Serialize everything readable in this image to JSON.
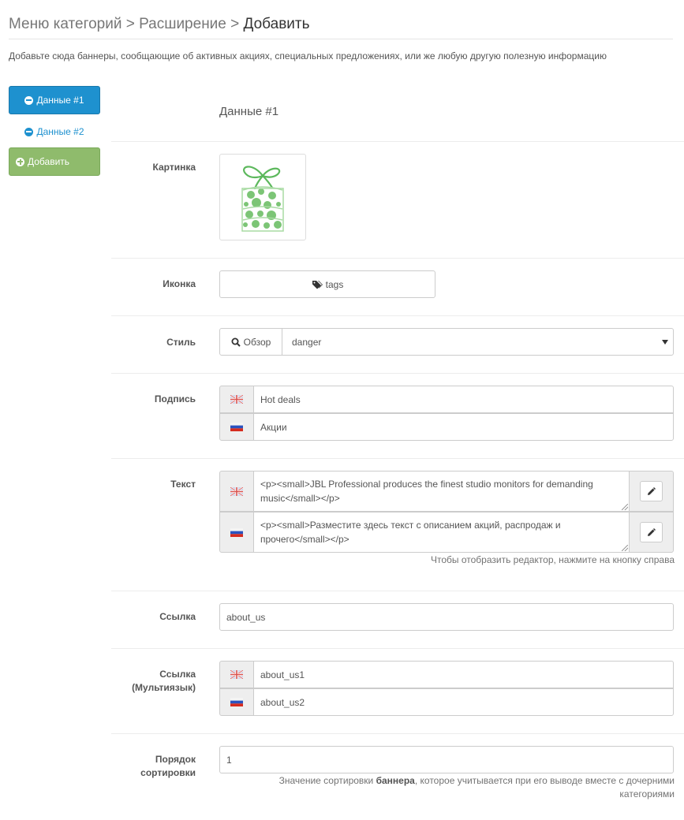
{
  "breadcrumb": {
    "part1": "Меню категорий",
    "sep1": " > ",
    "part2": "Расширение",
    "sep2": " > ",
    "current": "Добавить"
  },
  "intro": "Добавьте сюда баннеры, сообщающие об активных акциях, специальных предложениях, или же любую другую полезную информацию",
  "tabs": {
    "active": "Данные #1",
    "second": "Данные #2",
    "add": "Добавить"
  },
  "panel": {
    "title": "Данные #1"
  },
  "fields": {
    "image_label": "Картинка",
    "icon_label": "Иконка",
    "icon_value": "tags",
    "style_label": "Стиль",
    "style_browse": "Обзор",
    "style_value": "danger",
    "caption_label": "Подпись",
    "caption_en": "Hot deals",
    "caption_ru": "Акции",
    "text_label": "Текст",
    "text_en": "<p><small>JBL Professional produces the finest studio monitors for demanding music</small></p>",
    "text_ru": "<p><small>Разместите здесь текст с описанием акций, распродаж и прочего</small></p>",
    "text_help": "Чтобы отобразить редактор, нажмите на кнопку справа",
    "link_label": "Ссылка",
    "link_value": "about_us",
    "link_multi_label_1": "Ссылка",
    "link_multi_label_2": "(Мультиязык)",
    "link_multi_en": "about_us1",
    "link_multi_ru": "about_us2",
    "sort_label_1": "Порядок",
    "sort_label_2": "сортировки",
    "sort_value": "1",
    "sort_help_1": "Значение сортировки ",
    "sort_help_bold": "баннера",
    "sort_help_2": ", которое учитывается при его выводе вместе с дочерними",
    "sort_help_3": "категориями"
  },
  "icons": {
    "tab_active": "minus-circle-icon",
    "tab_second": "minus-circle-icon",
    "tab_add": "plus-circle-icon",
    "icon_field": "tag-icon",
    "browse": "search-icon",
    "select": "caret-down-icon",
    "lang_en": "uk-flag-icon",
    "lang_ru": "ru-flag-icon",
    "edit": "pencil-icon",
    "image": "gift-icon"
  },
  "colors": {
    "primary": "#1e91cf",
    "success": "#8fbb6c",
    "gift": "#5cb85c"
  }
}
